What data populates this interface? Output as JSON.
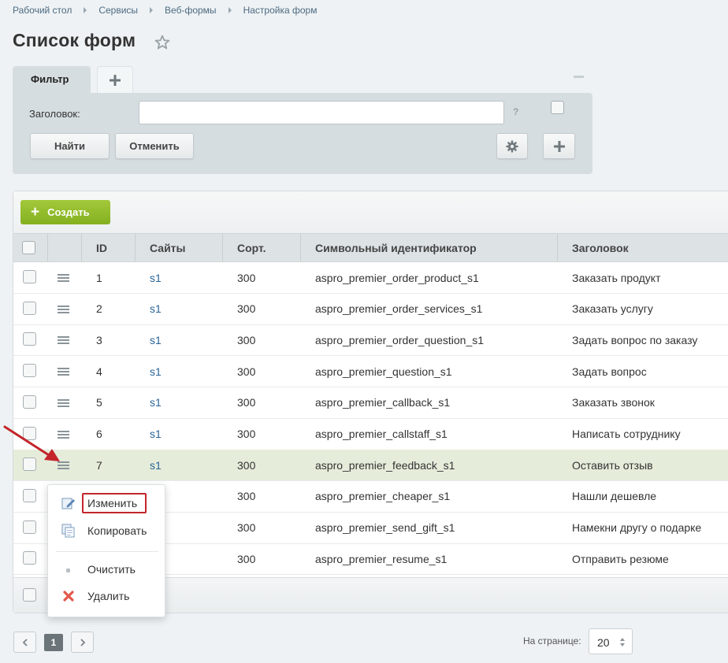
{
  "breadcrumb": [
    "Рабочий стол",
    "Сервисы",
    "Веб-формы",
    "Настройка форм"
  ],
  "page_title": "Список форм",
  "filter": {
    "tab_label": "Фильтр",
    "field_label": "Заголовок:",
    "field_value": "",
    "help": "?",
    "find_button": "Найти",
    "cancel_button": "Отменить"
  },
  "toolbar": {
    "create_label": "Создать"
  },
  "table": {
    "columns": [
      "ID",
      "Сайты",
      "Сорт.",
      "Символьный идентификатор",
      "Заголовок"
    ],
    "rows": [
      {
        "id": "1",
        "site": "s1",
        "sort": "300",
        "sid": "aspro_premier_order_product_s1",
        "title": "Заказать продукт"
      },
      {
        "id": "2",
        "site": "s1",
        "sort": "300",
        "sid": "aspro_premier_order_services_s1",
        "title": "Заказать услугу"
      },
      {
        "id": "3",
        "site": "s1",
        "sort": "300",
        "sid": "aspro_premier_order_question_s1",
        "title": "Задать вопрос по заказу"
      },
      {
        "id": "4",
        "site": "s1",
        "sort": "300",
        "sid": "aspro_premier_question_s1",
        "title": "Задать вопрос"
      },
      {
        "id": "5",
        "site": "s1",
        "sort": "300",
        "sid": "aspro_premier_callback_s1",
        "title": "Заказать звонок"
      },
      {
        "id": "6",
        "site": "s1",
        "sort": "300",
        "sid": "aspro_premier_callstaff_s1",
        "title": "Написать сотруднику"
      },
      {
        "id": "7",
        "site": "s1",
        "sort": "300",
        "sid": "aspro_premier_feedback_s1",
        "title": "Оставить отзыв"
      },
      {
        "id": "",
        "site": "",
        "sort": "300",
        "sid": "aspro_premier_cheaper_s1",
        "title": "Нашли дешевле"
      },
      {
        "id": "",
        "site": "",
        "sort": "300",
        "sid": "aspro_premier_send_gift_s1",
        "title": "Намекни другу о подарке"
      },
      {
        "id": "",
        "site": "",
        "sort": "300",
        "sid": "aspro_premier_resume_s1",
        "title": "Отправить резюме"
      }
    ]
  },
  "context_menu": {
    "edit": "Изменить",
    "copy": "Копировать",
    "clear": "Очистить",
    "delete": "Удалить"
  },
  "pager": {
    "current_page": "1",
    "per_page_label": "На странице:",
    "per_page_value": "20"
  },
  "icons": {
    "star": "star-icon",
    "gear": "gear-icon",
    "plus": "plus-icon",
    "row_menu": "hamburger-icon",
    "edit": "pencil-icon",
    "copy": "copy-icon",
    "clear": "dot-icon",
    "delete": "x-icon",
    "annotation": "red-arrow"
  },
  "colors": {
    "accent_green": "#8cb82a",
    "highlight_row": "#e5ecda",
    "link": "#2a6496",
    "annotation_red": "#c3252b"
  }
}
